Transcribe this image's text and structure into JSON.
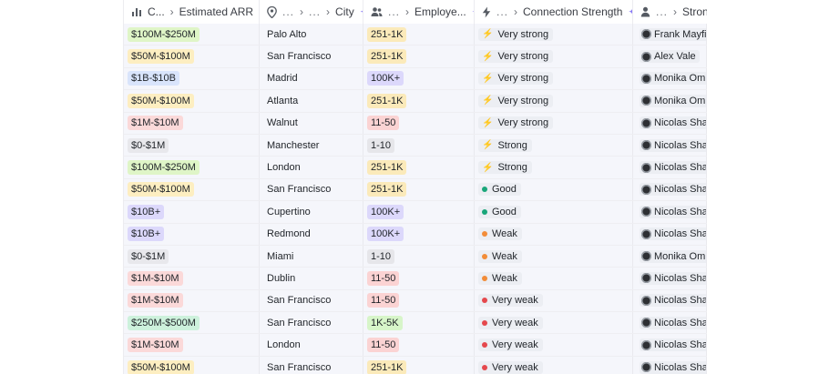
{
  "header": {
    "col1": {
      "label": "C...",
      "icon": "bar-chart-icon",
      "sub": "Estimated ARR"
    },
    "col2": {
      "label": "...",
      "icon": "location-pin-icon",
      "sub": "City"
    },
    "col3": {
      "label": "...",
      "icon": "people-icon",
      "sub": "Employe..."
    },
    "col4": {
      "label": "...",
      "icon": "lightning-icon",
      "sub": "Connection Strength"
    },
    "col5": {
      "label": "...",
      "icon": "person-icon",
      "sub": "Stronge"
    }
  },
  "colors": {
    "arr": {
      "$100M-$250M": "#dff5c7",
      "$50M-$100M": "#fdeec1",
      "$1B-$10B": "#d9e4fb",
      "$1M-$10M": "#fbd9d9",
      "$0-$1M": "#e8e8ec",
      "$10B+": "#dcd8fb",
      "$250M-$500M": "#cdf1dc"
    },
    "emp": {
      "251-1K": "#fbeaba",
      "100K+": "#dcd8fb",
      "11-50": "#fbd3d3",
      "1-10": "#e6e6ea",
      "1K-5K": "#d7f5c9"
    },
    "strength": {
      "Very strong": "#16a34a",
      "Strong": "#3cc7a0",
      "Good": "#19a67a",
      "Weak": "#f28c38",
      "Very weak": "#e5484d"
    }
  },
  "rows": [
    {
      "arr": "$100M-$250M",
      "city": "Palo Alto",
      "emp": "251-1K",
      "strength": "Very strong",
      "owner": "Frank Mayfield"
    },
    {
      "arr": "$50M-$100M",
      "city": "San Francisco",
      "emp": "251-1K",
      "strength": "Very strong",
      "owner": "Alex Vale"
    },
    {
      "arr": "$1B-$10B",
      "city": "Madrid",
      "emp": "100K+",
      "strength": "Very strong",
      "owner": "Monika Omrcen"
    },
    {
      "arr": "$50M-$100M",
      "city": "Atlanta",
      "emp": "251-1K",
      "strength": "Very strong",
      "owner": "Monika Omrcen"
    },
    {
      "arr": "$1M-$10M",
      "city": "Walnut",
      "emp": "11-50",
      "strength": "Very strong",
      "owner": "Nicolas Sharp"
    },
    {
      "arr": "$0-$1M",
      "city": "Manchester",
      "emp": "1-10",
      "strength": "Strong",
      "owner": "Nicolas Sharp"
    },
    {
      "arr": "$100M-$250M",
      "city": "London",
      "emp": "251-1K",
      "strength": "Strong",
      "owner": "Nicolas Sharp"
    },
    {
      "arr": "$50M-$100M",
      "city": "San Francisco",
      "emp": "251-1K",
      "strength": "Good",
      "owner": "Nicolas Sharp"
    },
    {
      "arr": "$10B+",
      "city": "Cupertino",
      "emp": "100K+",
      "strength": "Good",
      "owner": "Nicolas Sharp"
    },
    {
      "arr": "$10B+",
      "city": "Redmond",
      "emp": "100K+",
      "strength": "Weak",
      "owner": "Nicolas Sharp"
    },
    {
      "arr": "$0-$1M",
      "city": "Miami",
      "emp": "1-10",
      "strength": "Weak",
      "owner": "Monika Omrcen"
    },
    {
      "arr": "$1M-$10M",
      "city": "Dublin",
      "emp": "11-50",
      "strength": "Weak",
      "owner": "Nicolas Sharp"
    },
    {
      "arr": "$1M-$10M",
      "city": "San Francisco",
      "emp": "11-50",
      "strength": "Very weak",
      "owner": "Nicolas Sharp"
    },
    {
      "arr": "$250M-$500M",
      "city": "San Francisco",
      "emp": "1K-5K",
      "strength": "Very weak",
      "owner": "Nicolas Sharp"
    },
    {
      "arr": "$1M-$10M",
      "city": "London",
      "emp": "11-50",
      "strength": "Very weak",
      "owner": "Nicolas Sharp"
    },
    {
      "arr": "$50M-$100M",
      "city": "San Francisco",
      "emp": "251-1K",
      "strength": "Very weak",
      "owner": "Nicolas Sharp"
    }
  ]
}
